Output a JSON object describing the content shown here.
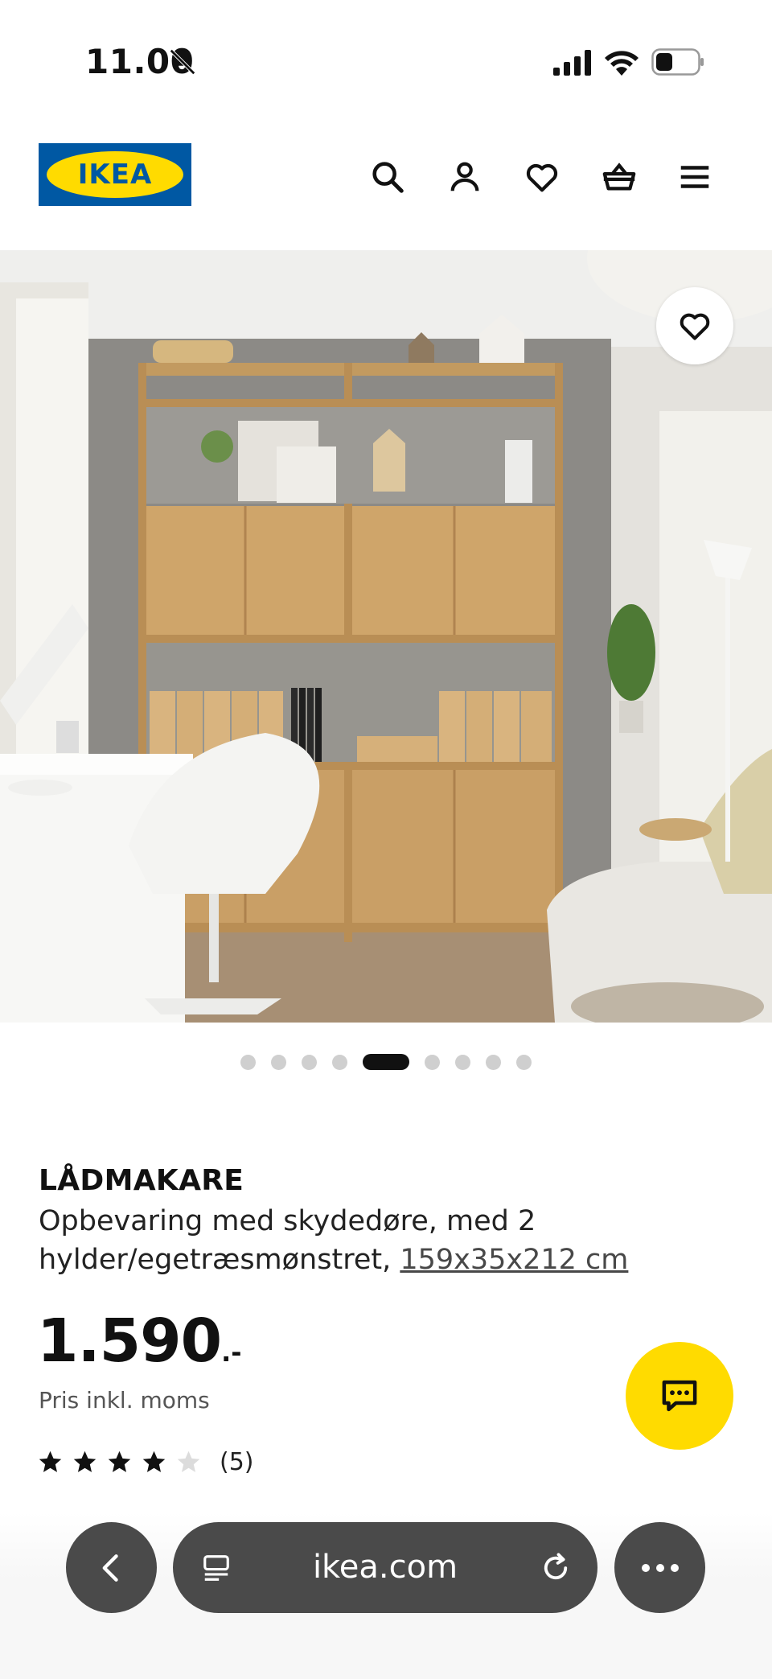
{
  "status_bar": {
    "time": "11.00",
    "icons": [
      "bell-slash-icon",
      "cellular-signal-icon",
      "wifi-icon",
      "battery-icon"
    ]
  },
  "header": {
    "logo_text": "IKEA",
    "icons": [
      "search-icon",
      "account-icon",
      "heart-icon",
      "shopping-basket-icon",
      "menu-icon"
    ],
    "brand_colors": {
      "blue": "#0058a3",
      "yellow": "#ffdb00"
    }
  },
  "gallery": {
    "image_count": 9,
    "active_index": 5,
    "favorite_icon": "heart-icon"
  },
  "product": {
    "name": "LÅDMAKARE",
    "description": "Opbevaring med skydedøre, med 2 hylder/egetræsmønstret,",
    "dimensions": "159x35x212 cm",
    "price": "1.590",
    "price_suffix": ".-",
    "price_note": "Pris inkl. moms",
    "rating": 4,
    "rating_max": 5,
    "review_count": "(5)"
  },
  "chat": {
    "icon": "chat-bubble-icon",
    "color": "#ffdb00"
  },
  "browser": {
    "url": "ikea.com",
    "icons": [
      "back-chevron-icon",
      "tab-list-icon",
      "reload-icon",
      "more-dots-icon"
    ]
  }
}
